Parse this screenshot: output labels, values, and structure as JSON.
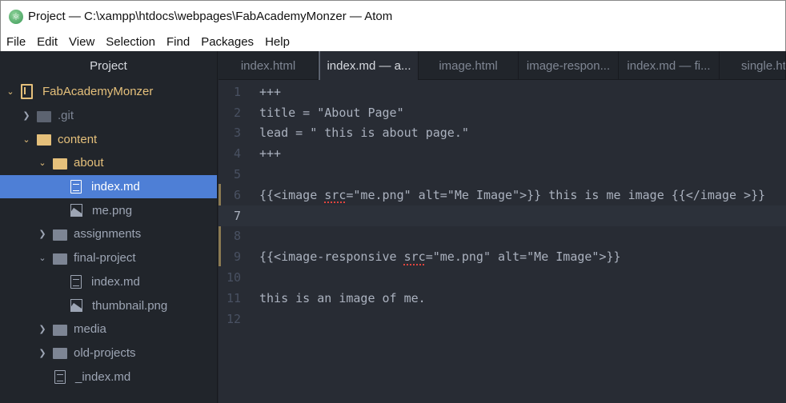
{
  "window": {
    "title": "Project — C:\\xampp\\htdocs\\webpages\\FabAcademyMonzer — Atom",
    "app_icon": "atom-icon"
  },
  "menubar": {
    "items": [
      "File",
      "Edit",
      "View",
      "Selection",
      "Find",
      "Packages",
      "Help"
    ]
  },
  "sidebar": {
    "title": "Project",
    "tree": [
      {
        "label": "FabAcademyMonzer",
        "type": "repo",
        "expanded": true,
        "depth": 0
      },
      {
        "label": ".git",
        "type": "folder",
        "expanded": false,
        "depth": 1,
        "ignored": true
      },
      {
        "label": "content",
        "type": "folder",
        "expanded": true,
        "depth": 1,
        "modified": true
      },
      {
        "label": "about",
        "type": "folder",
        "expanded": true,
        "depth": 2,
        "modified": true
      },
      {
        "label": "index.md",
        "type": "file",
        "depth": 3,
        "selected": true
      },
      {
        "label": "me.png",
        "type": "image",
        "depth": 3
      },
      {
        "label": "assignments",
        "type": "folder",
        "expanded": false,
        "depth": 2
      },
      {
        "label": "final-project",
        "type": "folder",
        "expanded": true,
        "depth": 2
      },
      {
        "label": "index.md",
        "type": "file",
        "depth": 3
      },
      {
        "label": "thumbnail.png",
        "type": "image",
        "depth": 3
      },
      {
        "label": "media",
        "type": "folder",
        "expanded": false,
        "depth": 2
      },
      {
        "label": "old-projects",
        "type": "folder",
        "expanded": false,
        "depth": 2
      },
      {
        "label": "_index.md",
        "type": "file",
        "depth": 2
      }
    ]
  },
  "tabs": [
    {
      "label": "index.html",
      "active": false
    },
    {
      "label": "index.md — a...",
      "active": true
    },
    {
      "label": "image.html",
      "active": false
    },
    {
      "label": "image-respon...",
      "active": false
    },
    {
      "label": "index.md — fi...",
      "active": false
    },
    {
      "label": "single.ht",
      "active": false
    }
  ],
  "editor": {
    "cursor_line": 7,
    "modified_lines": [
      6,
      7,
      8,
      9
    ],
    "lines": [
      {
        "n": "1",
        "text": "+++"
      },
      {
        "n": "2",
        "text": "title = \"About Page\""
      },
      {
        "n": "3",
        "text": "lead = \" this is about page.\""
      },
      {
        "n": "4",
        "text": "+++"
      },
      {
        "n": "5",
        "text": ""
      },
      {
        "n": "6",
        "pre": "{{<image ",
        "err": "src",
        "post": "=\"me.png\" alt=\"Me Image\">}} this is me image {{</image >}}"
      },
      {
        "n": "7",
        "text": ""
      },
      {
        "n": "8",
        "text": ""
      },
      {
        "n": "9",
        "pre": "{{<image-responsive ",
        "err": "src",
        "post": "=\"me.png\" alt=\"Me Image\">}}"
      },
      {
        "n": "10",
        "text": ""
      },
      {
        "n": "11",
        "text": "this is an image of me."
      },
      {
        "n": "12",
        "text": ""
      }
    ]
  },
  "colors": {
    "selection": "#4e7fd6",
    "modified": "#e5c07b",
    "editor_bg": "#282c34",
    "sidebar_bg": "#21252b"
  }
}
